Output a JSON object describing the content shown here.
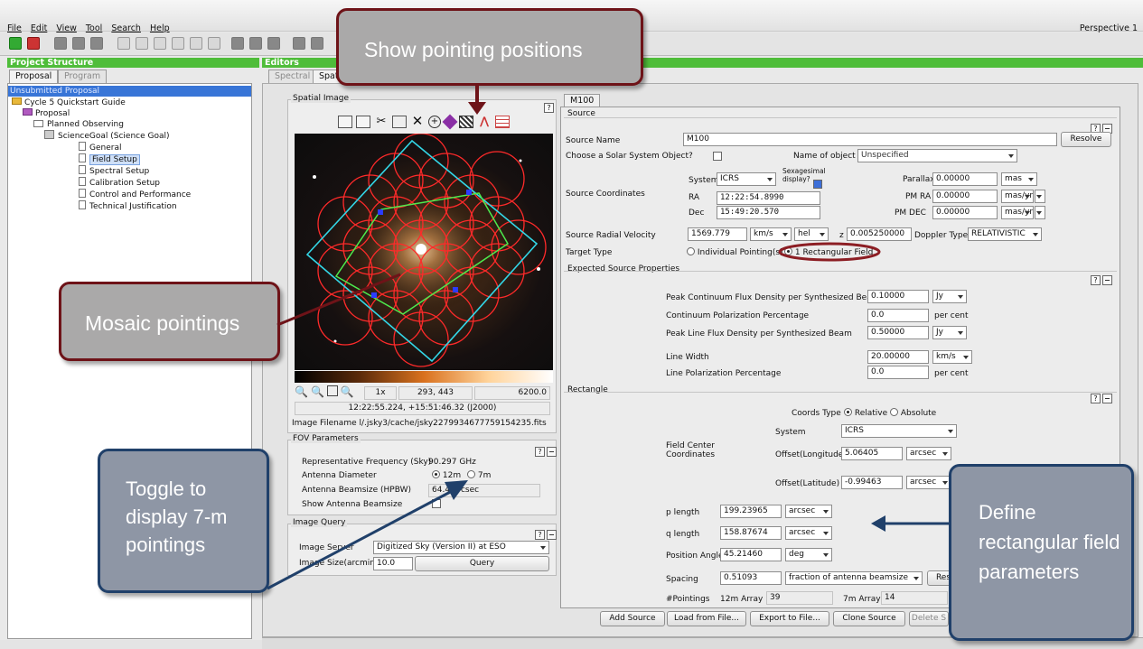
{
  "menubar": {
    "items": [
      "File",
      "Edit",
      "View",
      "Tool",
      "Search",
      "Help"
    ],
    "perspective": "Perspective 1"
  },
  "left_panel": {
    "title": "Project Structure",
    "tabs": [
      "Proposal",
      "Program"
    ],
    "tree": {
      "root": "Unsubmitted Proposal",
      "guide": "Cycle 5 Quickstart Guide",
      "proposal": "Proposal",
      "planned": "Planned Observing",
      "goal": "ScienceGoal (Science Goal)",
      "pages": [
        "General",
        "Field Setup",
        "Spectral Setup",
        "Calibration Setup",
        "Control and Performance",
        "Technical Justification"
      ]
    }
  },
  "editors": {
    "title": "Editors",
    "tabs": [
      "Spectral",
      "Spat"
    ]
  },
  "spatial": {
    "title": "Spatial Image",
    "zoom": "1x",
    "pixel": "293, 443",
    "value": "6200.0",
    "coords": "12:22:55.224, +15:51:46.32 (J2000)",
    "filename": "Image Filename l/.jsky3/cache/jsky2279934677759154235.fits"
  },
  "fov": {
    "title": "FOV Parameters",
    "freq_label": "Representative Frequency (Sky)",
    "freq_value": "90.297 GHz",
    "diam_label": "Antenna Diameter",
    "opt12": "12m",
    "opt7": "7m",
    "beam_label": "Antenna Beamsize (HPBW)",
    "beam_value": "64.4",
    "beam_unit": "arcsec",
    "show_label": "Show Antenna Beamsize"
  },
  "query": {
    "title": "Image Query",
    "server_label": "Image Server",
    "server_value": "Digitized Sky (Version II) at ESO",
    "size_label": "Image Size(arcmin)",
    "size_value": "10.0",
    "query_btn": "Query"
  },
  "m100": {
    "tab": "M100",
    "source_title": "Source",
    "name_label": "Source Name",
    "name_value": "M100",
    "resolve": "Resolve",
    "solar_label": "Choose a Solar System Object?",
    "obj_label": "Name of object",
    "obj_value": "Unspecified",
    "system_label": "System",
    "system_value": "ICRS",
    "sexa_label": "Sexagesimal display?",
    "coords_label": "Source Coordinates",
    "ra_label": "RA",
    "ra_value": "12:22:54.8990",
    "dec_label": "Dec",
    "dec_value": "15:49:20.570",
    "parallax_label": "Parallax",
    "parallax_value": "0.00000",
    "parallax_unit": "mas",
    "pmra_label": "PM RA",
    "pmra_value": "0.00000",
    "pmra_unit": "mas/yr",
    "pmdec_label": "PM DEC",
    "pmdec_value": "0.00000",
    "pmdec_unit": "mas/yr",
    "vel_label": "Source Radial Velocity",
    "vel_value": "1569.779",
    "vel_unit": "km/s",
    "vel_frame": "hel",
    "z_label": "z",
    "z_value": "0.005250000",
    "doppler_label": "Doppler Type",
    "doppler_value": "RELATIVISTIC",
    "target_label": "Target Type",
    "target_opt1": "Individual Pointing(s)",
    "target_opt2": "1 Rectangular Field"
  },
  "expected": {
    "title": "Expected Source Properties",
    "peak_label": "Peak Continuum Flux Density per Synthesized Beam",
    "peak_value": "0.10000",
    "peak_unit": "Jy",
    "pol_label": "Continuum Polarization Percentage",
    "pol_value": "0.0",
    "pol_unit": "per cent",
    "line_label": "Peak Line Flux Density per Synthesized Beam",
    "line_value": "0.50000",
    "line_unit": "Jy",
    "width_label": "Line Width",
    "width_value": "20.00000",
    "width_unit": "km/s",
    "lpol_label": "Line Polarization Percentage",
    "lpol_value": "0.0",
    "lpol_unit": "per cent"
  },
  "rect": {
    "title": "Rectangle",
    "coords_type": "Coords Type",
    "rel": "Relative",
    "absl": "Absolute",
    "system_label": "System",
    "system_value": "ICRS",
    "fc_label1": "Field Center",
    "fc_label2": "Coordinates",
    "offlon_label": "Offset(Longitude)",
    "offlon_value": "5.06405",
    "offlon_unit": "arcsec",
    "offlat_label": "Offset(Latitude)",
    "offlat_value": "-0.99463",
    "offlat_unit": "arcsec",
    "p_label": "p length",
    "p_value": "199.23965",
    "p_unit": "arcsec",
    "q_label": "q length",
    "q_value": "158.87674",
    "q_unit": "arcsec",
    "pa_label": "Position Angle",
    "pa_value": "45.21460",
    "pa_unit": "deg",
    "sp_label": "Spacing",
    "sp_value": "0.51093",
    "sp_unit": "fraction of antenna beamsize",
    "reset": "Res",
    "np_label": "#Pointings",
    "a12_label": "12m Array",
    "a12_value": "39",
    "a7_label": "7m Array",
    "a7_value": "14"
  },
  "bottom_buttons": [
    "Add Source",
    "Load from File...",
    "Export to File...",
    "Clone Source",
    "Delete S"
  ],
  "callouts": {
    "pointing": "Show pointing positions",
    "mosaic": "Mosaic pointings",
    "toggle": "Toggle to display 7-m pointings",
    "define": "Define rectangular field parameters"
  },
  "colors": {
    "accent_green": "#4fbd3a",
    "callout_red": "#6e1318",
    "callout_blue": "#20406a",
    "pointing_red": "#ff2a2a",
    "field_cyan": "#33d6e6"
  }
}
